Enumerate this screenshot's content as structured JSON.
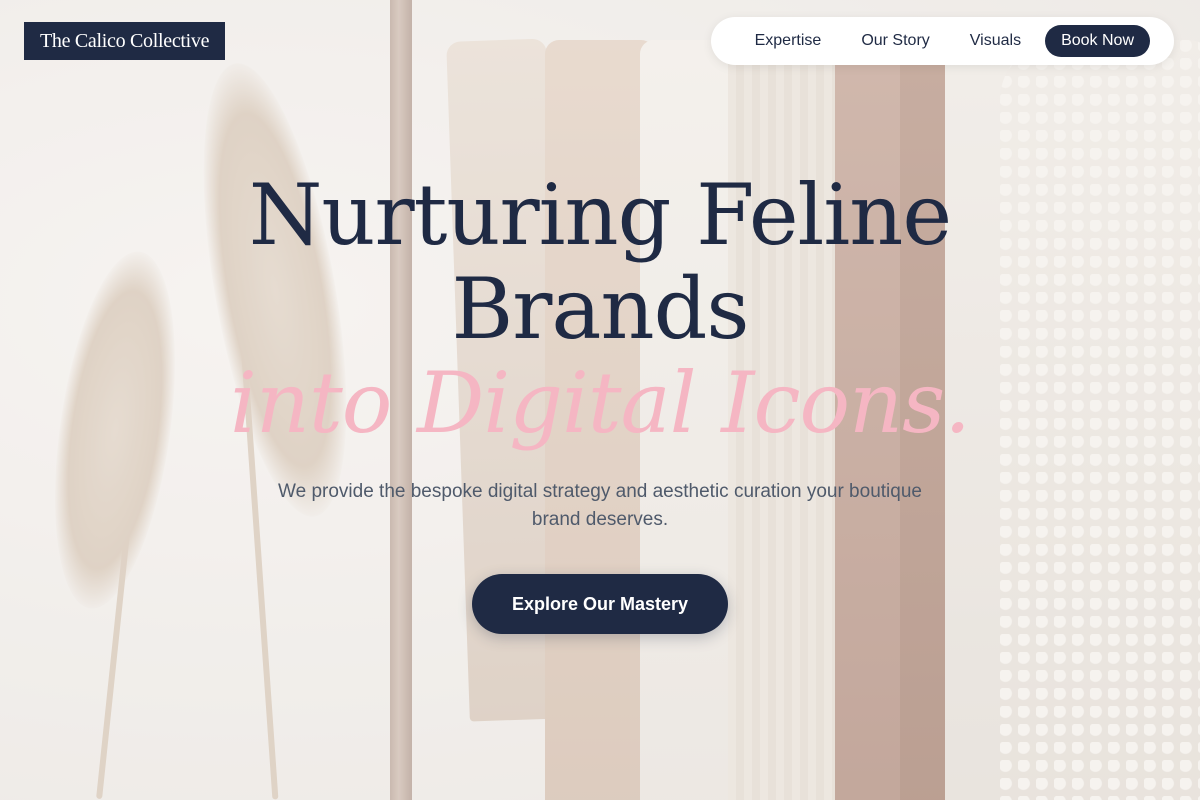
{
  "header": {
    "logo_text": "The Calico Collective",
    "nav": [
      {
        "label": "Expertise"
      },
      {
        "label": "Our Story"
      },
      {
        "label": "Visuals"
      }
    ],
    "cta_label": "Book Now"
  },
  "hero": {
    "title_line1": "Nurturing Feline",
    "title_line2": "Brands",
    "title_accent": "into Digital Icons.",
    "subtitle": "We provide the bespoke digital strategy and aesthetic curation your boutique brand deserves.",
    "button_label": "Explore Our Mastery"
  },
  "colors": {
    "navy": "#1f2a44",
    "accent_pink": "#f5b6c3",
    "body_text": "#4f5a6b"
  }
}
